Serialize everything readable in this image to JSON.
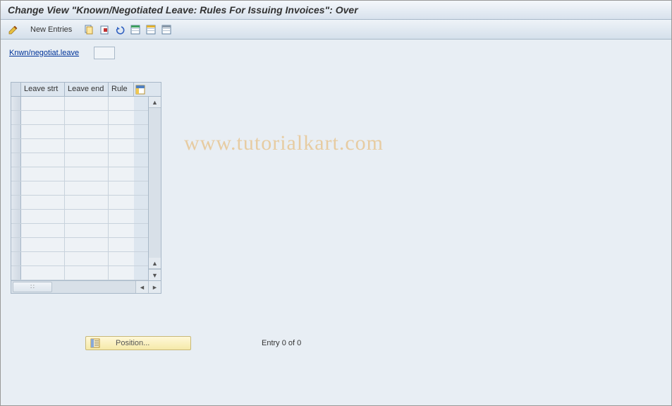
{
  "title": "Change View \"Known/Negotiated Leave: Rules For Issuing Invoices\": Over",
  "toolbar": {
    "new_entries": "New Entries"
  },
  "field": {
    "label": "Knwn/negotiat.leave",
    "value": ""
  },
  "table": {
    "columns": [
      "Leave strt",
      "Leave end",
      "Rule"
    ],
    "rows": [
      {
        "leave_strt": "",
        "leave_end": "",
        "rule": ""
      },
      {
        "leave_strt": "",
        "leave_end": "",
        "rule": ""
      },
      {
        "leave_strt": "",
        "leave_end": "",
        "rule": ""
      },
      {
        "leave_strt": "",
        "leave_end": "",
        "rule": ""
      },
      {
        "leave_strt": "",
        "leave_end": "",
        "rule": ""
      },
      {
        "leave_strt": "",
        "leave_end": "",
        "rule": ""
      },
      {
        "leave_strt": "",
        "leave_end": "",
        "rule": ""
      },
      {
        "leave_strt": "",
        "leave_end": "",
        "rule": ""
      },
      {
        "leave_strt": "",
        "leave_end": "",
        "rule": ""
      },
      {
        "leave_strt": "",
        "leave_end": "",
        "rule": ""
      },
      {
        "leave_strt": "",
        "leave_end": "",
        "rule": ""
      },
      {
        "leave_strt": "",
        "leave_end": "",
        "rule": ""
      },
      {
        "leave_strt": "",
        "leave_end": "",
        "rule": ""
      }
    ]
  },
  "footer": {
    "position_label": "Position...",
    "entry_text": "Entry 0 of 0"
  },
  "watermark": "www.tutorialkart.com"
}
